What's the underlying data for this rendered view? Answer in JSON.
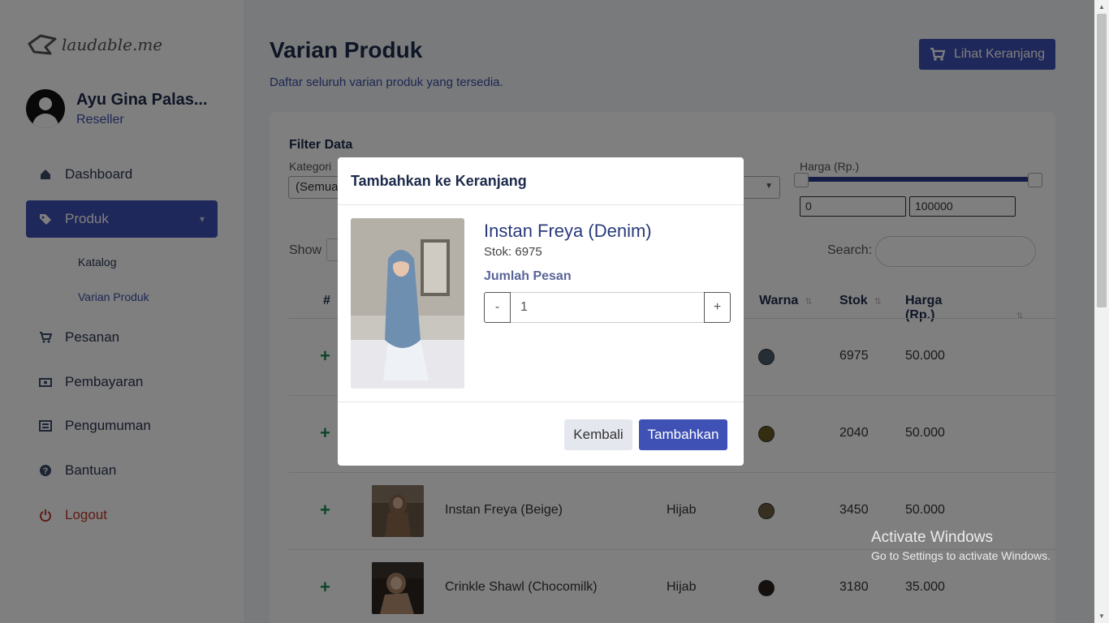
{
  "brand": {
    "logo_text": "laudable.me"
  },
  "profile": {
    "name": "Ayu Gina Palas...",
    "role": "Reseller"
  },
  "sidebar": {
    "items": [
      {
        "label": "Dashboard",
        "icon": "home-icon"
      },
      {
        "label": "Produk",
        "icon": "tag-icon",
        "active": true
      },
      {
        "label": "Pesanan",
        "icon": "cart-icon"
      },
      {
        "label": "Pembayaran",
        "icon": "money-icon"
      },
      {
        "label": "Pengumuman",
        "icon": "newspaper-icon"
      },
      {
        "label": "Bantuan",
        "icon": "help-icon"
      },
      {
        "label": "Logout",
        "icon": "power-icon"
      }
    ],
    "sub_items": [
      {
        "label": "Katalog"
      },
      {
        "label": "Varian Produk",
        "current": true
      }
    ]
  },
  "page": {
    "title": "Varian Produk",
    "subtitle": "Daftar seluruh varian produk yang tersedia.",
    "cart_button": "Lihat Keranjang"
  },
  "filter": {
    "title": "Filter Data",
    "kategori_label": "Kategori",
    "kategori_value": "(Semua",
    "harga_label": "Harga (Rp.)",
    "harga_min": "0",
    "harga_max": "100000"
  },
  "table": {
    "show_label": "Show",
    "search_label": "Search:",
    "headers": {
      "no": "#",
      "warna": "Warna",
      "stok": "Stok",
      "harga": "Harga (Rp.)"
    },
    "rows": [
      {
        "name": "",
        "category": "",
        "color": "#4a5a6a",
        "stock": "6975",
        "price": "50.000"
      },
      {
        "name": "",
        "category": "",
        "color": "#6b5a20",
        "stock": "2040",
        "price": "50.000"
      },
      {
        "name": "Instan Freya (Beige)",
        "category": "Hijab",
        "color": "#6e6040",
        "stock": "3450",
        "price": "50.000"
      },
      {
        "name": "Crinkle Shawl (Chocomilk)",
        "category": "Hijab",
        "color": "#2a2018",
        "stock": "3180",
        "price": "35.000"
      }
    ]
  },
  "modal": {
    "title": "Tambahkan ke Keranjang",
    "product_name": "Instan Freya (Denim)",
    "stock_text": "Stok: 6975",
    "qty_label": "Jumlah Pesan",
    "qty_value": "1",
    "minus": "-",
    "plus": "+",
    "back_button": "Kembali",
    "add_button": "Tambahkan"
  },
  "watermark": {
    "title": "Activate Windows",
    "subtitle": "Go to Settings to activate Windows."
  },
  "colors": {
    "primary": "#3f51b5",
    "add_green": "#1b8a4f",
    "logout_red": "#c0392b"
  }
}
